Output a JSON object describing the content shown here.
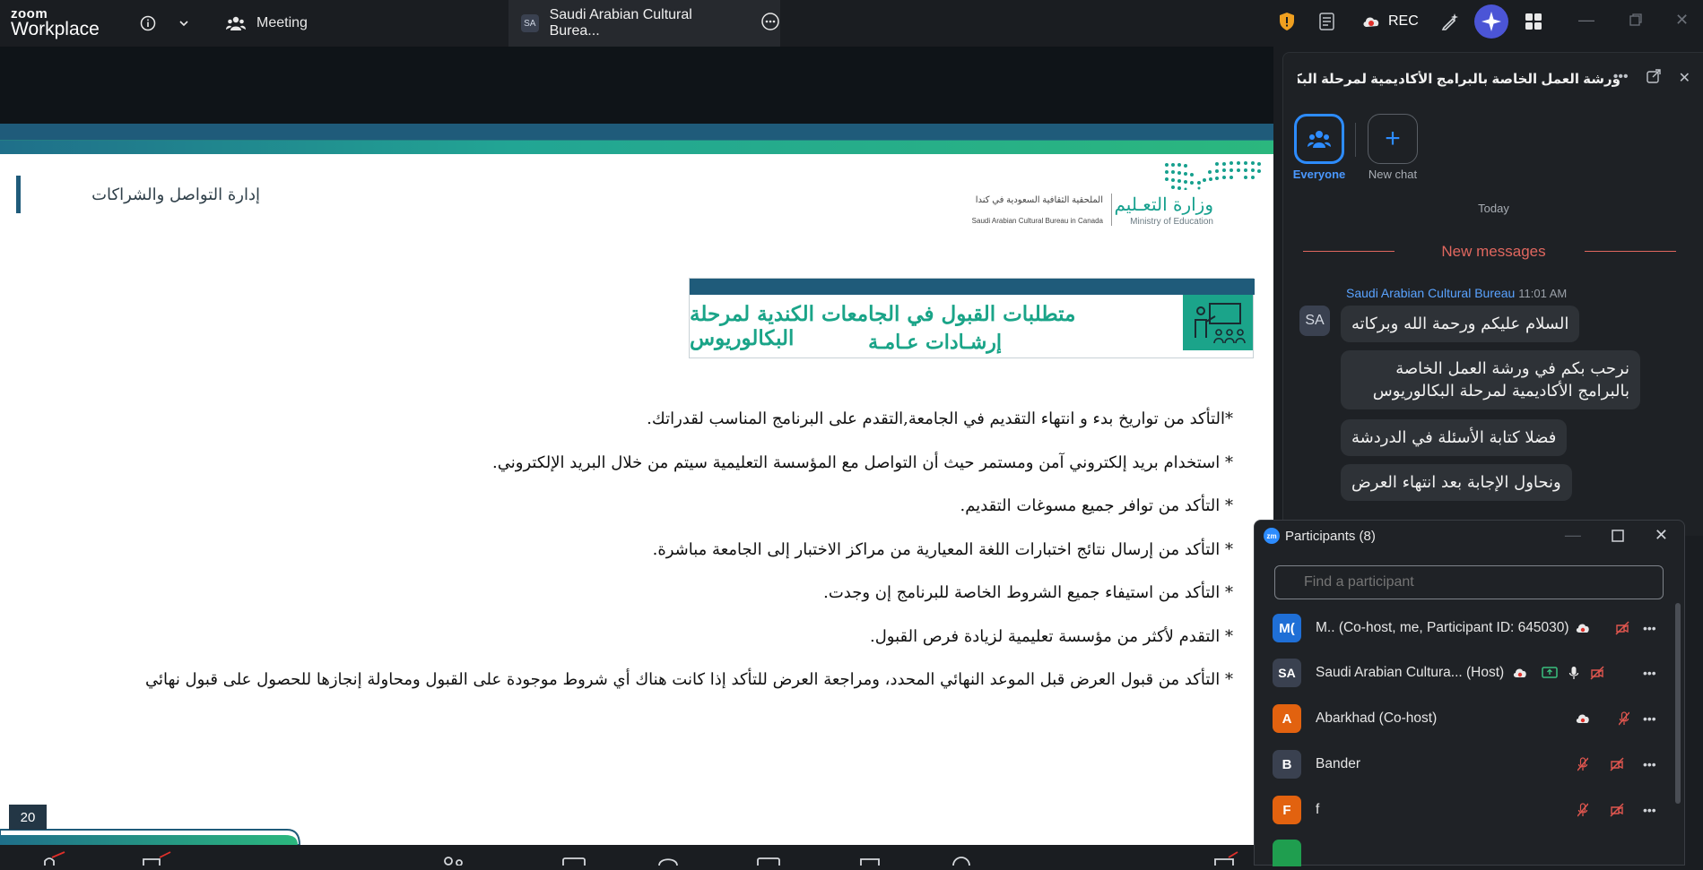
{
  "topbar": {
    "logo_top": "zoom",
    "logo_bottom": "Workplace",
    "meeting_label": "Meeting",
    "tab_badge": "SA",
    "tab_title": "Saudi Arabian Cultural Burea...",
    "rec_label": "REC"
  },
  "slide": {
    "department": "إدارة التواصل والشراكات",
    "ministry_ar": "وزارة التعـليم",
    "ministry_en": "Ministry of Education",
    "bureau_ar": "الملحقية الثقافية السعودية في كندا",
    "bureau_en": "Saudi Arabian Cultural Bureau in Canada",
    "title_line1": "متطلبات القبول في الجامعات الكندية لمرحلة البكالوريوس",
    "title_line2": "إرشـادات عـامـة",
    "bullets": [
      "*التأكد من تواريخ بدء و انتهاء التقديم في الجامعة,التقدم على البرنامج المناسب لقدراتك.",
      "* استخدام بريد إلكتروني آمن ومستمر حيث أن التواصل مع المؤسسة التعليمية سيتم من خلال البريد الإلكتروني.",
      "* التأكد من توافر جميع مسوغات التقديم.",
      "* التأكد من إرسال نتائج اختبارات اللغة المعيارية من مراكز الاختبار إلى الجامعة مباشرة.",
      "* التأكد من استيفاء جميع الشروط الخاصة للبرنامج إن وجدت.",
      "* التقدم لأكثر من مؤسسة تعليمية لزيادة فرص القبول.",
      "* التأكد من قبول العرض قبل الموعد النهائي المحدد، ومراجعة العرض للتأكد إذا كانت هناك أي شروط موجودة على القبول ومحاولة إنجازها للحصول على قبول نهائي"
    ],
    "page_number": "20"
  },
  "chat": {
    "title": "ورشة العمل الخاصة بالبرامج الأكاديمية لمرحلة البكالو...",
    "everyone_label": "Everyone",
    "new_chat_label": "New chat",
    "today_label": "Today",
    "new_messages_label": "New messages",
    "sender": "Saudi Arabian Cultural Bureau",
    "time": "11:01 AM",
    "avatar": "SA",
    "messages": [
      "السلام عليكم ورحمة الله وبركاته",
      "نرحب بكم في ورشة العمل الخاصة بالبرامج الأكاديمية لمرحلة البكالوريوس",
      "فضلا كتابة الأسئلة في الدردشة",
      "ونحاول الإجابة بعد انتهاء العرض"
    ]
  },
  "participants": {
    "logo": "zm",
    "title": "Participants (8)",
    "search_placeholder": "Find a participant",
    "rows": [
      {
        "initials": "M(",
        "name": "M.. (Co-host, me, Participant ID: 645030)",
        "color": "#1f6fd6"
      },
      {
        "initials": "SA",
        "name": "Saudi Arabian Cultura... (Host)",
        "color": "#3a4150"
      },
      {
        "initials": "A",
        "name": "Abarkhad (Co-host)",
        "color": "#e2620f"
      },
      {
        "initials": "B",
        "name": "Bander",
        "color": "#3a4150"
      },
      {
        "initials": "F",
        "name": "f",
        "color": "#e2620f"
      }
    ]
  },
  "colors": {
    "accent": "#2d8cff",
    "slide_teal": "#1aa488",
    "slide_navy": "#1f5b7a",
    "muted_red": "#e0564f"
  }
}
